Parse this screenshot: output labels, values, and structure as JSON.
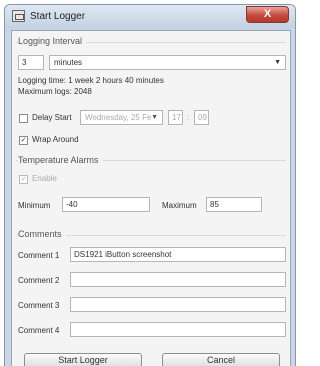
{
  "window": {
    "title": "Start Logger",
    "close_label": "X"
  },
  "logging": {
    "section_label": "Logging Interval",
    "interval_value": "3",
    "unit": "minutes",
    "logging_time": "Logging time: 1 week 2 hours 40 minutes",
    "maximum_logs": "Maximum logs: 2048",
    "delay_start_label": "Delay Start",
    "delay_start_checked": false,
    "delay_date": "Wednesday, 25  Fe",
    "delay_hour": "17",
    "delay_minute": "09",
    "wrap_around_label": "Wrap Around",
    "wrap_around_checked": true
  },
  "alarms": {
    "section_label": "Temperature Alarms",
    "enable_label": "Enable",
    "enable_checked": true,
    "minimum_label": "Minimum",
    "minimum_value": "-40",
    "maximum_label": "Maximum",
    "maximum_value": "85"
  },
  "comments": {
    "section_label": "Comments",
    "items": [
      {
        "label": "Comment 1",
        "value": "DS1921 iButton screenshot"
      },
      {
        "label": "Comment 2",
        "value": ""
      },
      {
        "label": "Comment 3",
        "value": ""
      },
      {
        "label": "Comment 4",
        "value": ""
      }
    ]
  },
  "buttons": {
    "start_label": "Start Logger",
    "cancel_label": "Cancel"
  }
}
